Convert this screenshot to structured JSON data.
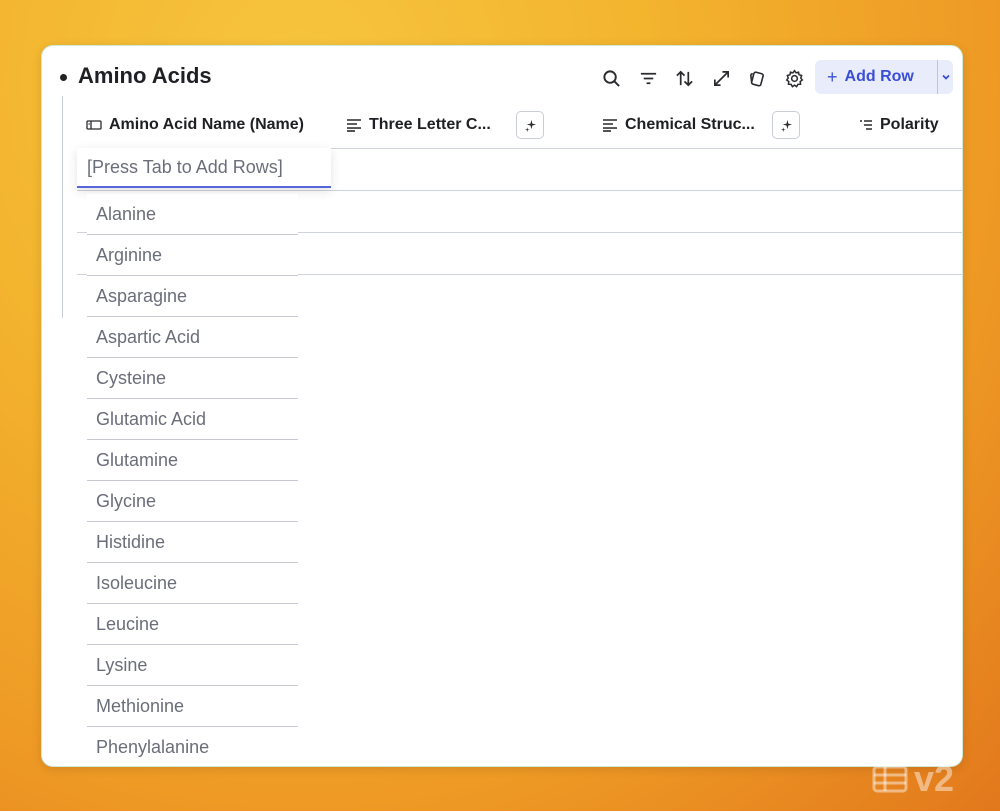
{
  "page": {
    "title": "Amino Acids",
    "add_row_label": "Add Row"
  },
  "toolbar": {
    "icons": [
      "search-icon",
      "filter-icon",
      "sort-icon",
      "expand-icon",
      "copy-icon",
      "gear-icon"
    ]
  },
  "columns": [
    {
      "label": "Amino Acid Name (Name)",
      "icon": "name-field-icon"
    },
    {
      "label": "Three Letter C...",
      "icon": "text-field-icon"
    },
    {
      "label": "Chemical Struc...",
      "icon": "text-field-icon"
    },
    {
      "label": "Polarity",
      "icon": "list-field-icon"
    }
  ],
  "input": {
    "placeholder": "[Press Tab to Add Rows]"
  },
  "dropdown": {
    "items": [
      "Alanine",
      "Arginine",
      "Asparagine",
      "Aspartic Acid",
      "Cysteine",
      "Glutamic Acid",
      "Glutamine",
      "Glycine",
      "Histidine",
      "Isoleucine",
      "Leucine",
      "Lysine",
      "Methionine",
      "Phenylalanine"
    ]
  },
  "badge": {
    "label": "v2"
  },
  "colors": {
    "accent": "#3b4fd6",
    "accent_bg": "#e9ecfb"
  }
}
